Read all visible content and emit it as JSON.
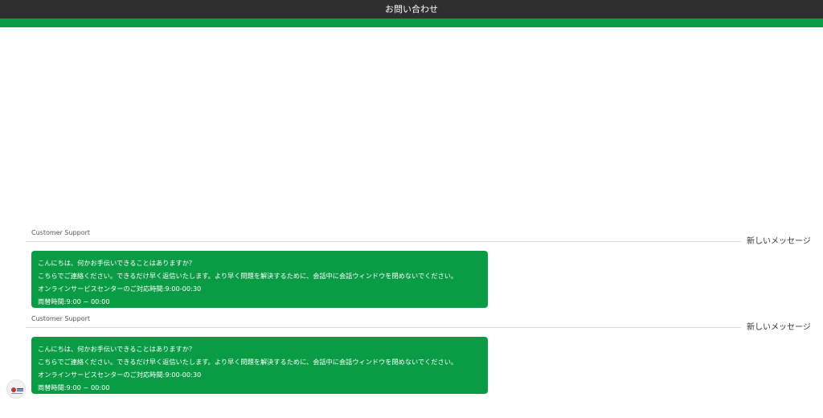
{
  "header": {
    "title": "お問い合わせ"
  },
  "colors": {
    "header_bg": "#2f2f2f",
    "accent": "#0a9b45",
    "bubble_bg": "#0a9b45",
    "bubble_text": "#ffffff"
  },
  "messages": [
    {
      "sender": "Customer Support",
      "new_label": "新しいメッセージ",
      "lines": [
        "こんにちは、何かお手伝いできることはありますか？",
        "こちらでご連絡ください。できるだけ早く返信いたします。より早く問題を解決するために、会話中に会話ウィンドウを閉めないでください。",
        "オンラインサービスセンターのご対応時間:9:00-00:30",
        "両替時間:9:00 ~ 00:00"
      ]
    },
    {
      "sender": "Customer Support",
      "new_label": "新しいメッセージ",
      "lines": [
        "こんにちは、何かお手伝いできることはありますか？",
        "こちらでご連絡ください。できるだけ早く返信いたします。より早く問題を解決するために、会話中に会話ウィンドウを閉めないでください。",
        "オンラインサービスセンターのご対応時間:9:00-00:30",
        "両替時間:9:00 ~ 00:00"
      ]
    }
  ],
  "avatar": {
    "icon": "support-logo-icon"
  }
}
